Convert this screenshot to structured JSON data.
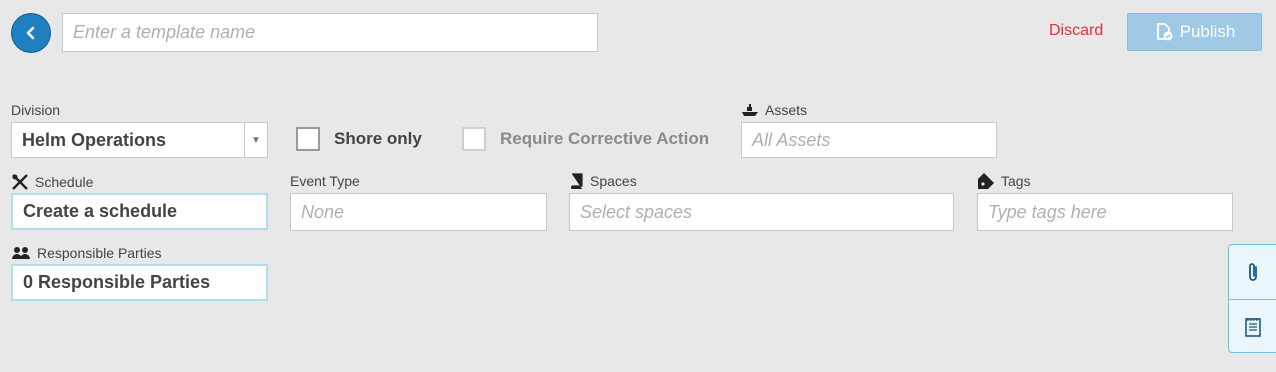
{
  "header": {
    "back_icon": "chevron-left-icon",
    "template_name_value": "",
    "template_name_placeholder": "Enter a template name",
    "discard_label": "Discard",
    "publish_label": "Publish",
    "publish_icon": "document-check-icon"
  },
  "form": {
    "division": {
      "label": "Division",
      "value": "Helm Operations"
    },
    "shore_only": {
      "label": "Shore only",
      "checked": false
    },
    "require_corrective": {
      "label": "Require Corrective Action",
      "checked": false,
      "disabled": true
    },
    "assets": {
      "label": "Assets",
      "icon": "ship-icon",
      "placeholder": "All Assets"
    },
    "schedule": {
      "label": "Schedule",
      "icon": "tools-icon",
      "value": "Create a schedule"
    },
    "event_type": {
      "label": "Event Type",
      "placeholder": "None"
    },
    "spaces": {
      "label": "Spaces",
      "icon": "book-icon",
      "placeholder": "Select spaces"
    },
    "tags": {
      "label": "Tags",
      "icon": "tag-icon",
      "placeholder": "Type tags here"
    },
    "responsible": {
      "label": "Responsible Parties",
      "icon": "people-icon",
      "value": "0 Responsible Parties"
    }
  },
  "side_panel": {
    "icons": [
      "paperclip-icon",
      "notes-icon"
    ]
  },
  "colors": {
    "accent": "#1f7fc0",
    "publish_disabled": "#9fc9e5",
    "discard": "#e0303a",
    "highlight_border": "#aee0e8"
  }
}
